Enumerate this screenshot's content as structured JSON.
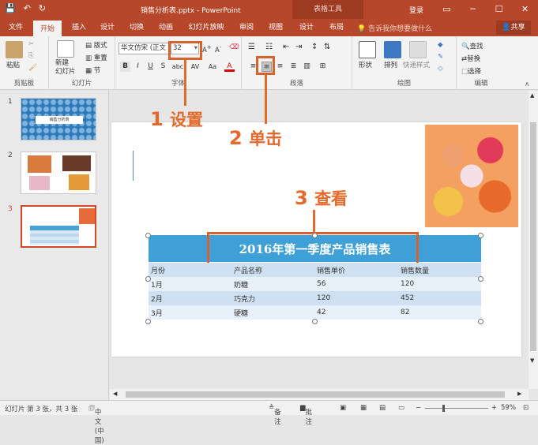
{
  "window": {
    "title": "销售分析表.pptx - PowerPoint",
    "context_tab": "表格工具",
    "login": "登录",
    "share": "共享"
  },
  "qat": {
    "save": "💾",
    "undo": "↶",
    "redo": "↻"
  },
  "tabs": [
    "文件",
    "开始",
    "插入",
    "设计",
    "切换",
    "动画",
    "幻灯片放映",
    "审阅",
    "视图",
    "设计",
    "布局"
  ],
  "tell_me": "告诉我你想要做什么",
  "ribbon": {
    "clipboard": {
      "label": "剪贴板",
      "paste": "粘贴"
    },
    "slides": {
      "label": "幻灯片",
      "new_slide": "新建\n幻灯片",
      "layout": "版式",
      "reset": "重置",
      "section": "节"
    },
    "font": {
      "label": "字体",
      "font_name": "华文仿宋 (正文",
      "font_size": "32"
    },
    "paragraph": {
      "label": "段落"
    },
    "drawing": {
      "label": "绘图",
      "shape": "形状",
      "arrange": "排列",
      "quick_style": "快速样式"
    },
    "editing": {
      "label": "编辑",
      "find": "查找",
      "replace": "替换",
      "select": "选择"
    }
  },
  "slides_pane": [
    {
      "num": "1",
      "caption": "销售分析表"
    },
    {
      "num": "2"
    },
    {
      "num": "3"
    }
  ],
  "annotations": [
    {
      "num": "1",
      "text": "设置"
    },
    {
      "num": "2",
      "text": "单击"
    },
    {
      "num": "3",
      "text": "查看"
    }
  ],
  "slide": {
    "table_title": "2016年第一季度产品销售表",
    "headers": [
      "月份",
      "产品名称",
      "销售单价",
      "销售数量"
    ],
    "rows": [
      [
        "1月",
        "奶糖",
        "56",
        "120"
      ],
      [
        "2月",
        "巧克力",
        "120",
        "452"
      ],
      [
        "3月",
        "硬糖",
        "42",
        "82"
      ]
    ]
  },
  "status": {
    "slide_info": "幻灯片 第 3 张，共 3 张",
    "language": "中文(中国)",
    "notes": "备注",
    "comments": "批注",
    "zoom": "59%"
  }
}
